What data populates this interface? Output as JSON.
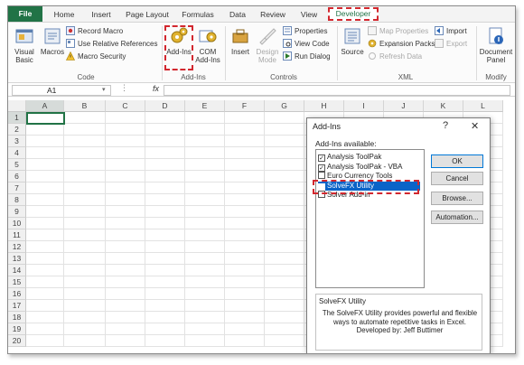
{
  "ribbon_tabs": {
    "file": "File",
    "home": "Home",
    "insert": "Insert",
    "page_layout": "Page Layout",
    "formulas": "Formulas",
    "data": "Data",
    "review": "Review",
    "view": "View",
    "developer": "Developer"
  },
  "code_group": {
    "visual_basic": "Visual Basic",
    "macros": "Macros",
    "record_macro": "Record Macro",
    "relative_refs": "Use Relative References",
    "macro_security": "Macro Security",
    "label": "Code"
  },
  "addins_group": {
    "addins": "Add-Ins",
    "com_addins": "COM Add-Ins",
    "label": "Add-Ins"
  },
  "controls_group": {
    "insert": "Insert",
    "design_mode": "Design Mode",
    "properties": "Properties",
    "view_code": "View Code",
    "run_dialog": "Run Dialog",
    "label": "Controls"
  },
  "xml_group": {
    "source": "Source",
    "map_properties": "Map Properties",
    "expansion_packs": "Expansion Packs",
    "refresh_data": "Refresh Data",
    "import": "Import",
    "export": "Export",
    "label": "XML"
  },
  "modify_group": {
    "document_panel": "Document Panel",
    "label": "Modify"
  },
  "formula_bar": {
    "name_box": "A1",
    "fx": "fx"
  },
  "grid": {
    "columns": [
      "A",
      "B",
      "C",
      "D",
      "E",
      "F",
      "G",
      "H",
      "I",
      "J",
      "K",
      "L"
    ],
    "rows": [
      "1",
      "2",
      "3",
      "4",
      "5",
      "6",
      "7",
      "8",
      "9",
      "10",
      "11",
      "12",
      "13",
      "14",
      "15",
      "16",
      "17",
      "18",
      "19",
      "20"
    ]
  },
  "dialog": {
    "title": "Add-Ins",
    "help": "?",
    "close": "✕",
    "available_label": "Add-Ins available:",
    "items": [
      {
        "label": "Analysis ToolPak",
        "checked": true
      },
      {
        "label": "Analysis ToolPak - VBA",
        "checked": true
      },
      {
        "label": "Euro Currency Tools",
        "checked": false
      },
      {
        "label": "SolveFX Utility",
        "checked": true
      },
      {
        "label": "Solver Add-in",
        "checked": false
      }
    ],
    "ok": "OK",
    "cancel": "Cancel",
    "browse": "Browse...",
    "automation": "Automation...",
    "desc_title": "SolveFX Utility",
    "desc_text": "The SolveFX Utility provides powerful and flexible ways to automate repetitive tasks in Excel. Developed by: Jeff Buttimer"
  },
  "colors": {
    "excel_green": "#217346",
    "highlight_red": "#d2272e",
    "selection_blue": "#0a64c8"
  }
}
